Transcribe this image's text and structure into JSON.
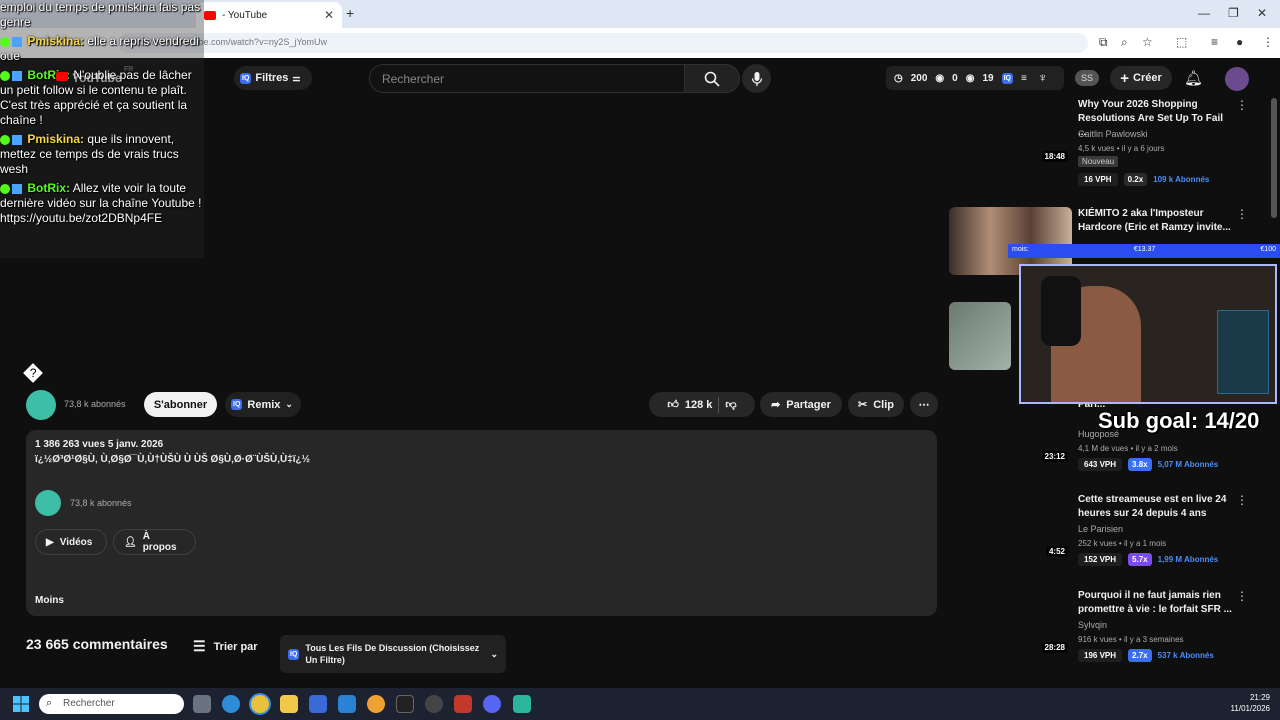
{
  "browser": {
    "tab_title": "- YouTube",
    "url": "https://www.youtube.com/watch?v=ny2S_jYomUw",
    "new_tab_glyph": "+",
    "close_glyph": "✕"
  },
  "youtube": {
    "logo": "YouTube",
    "country": "FR",
    "filters_label": "Filtres",
    "iq_label": "IQ",
    "search_placeholder": "Rechercher",
    "stats": {
      "a": "200",
      "b": "0",
      "c": "19"
    },
    "ss_label": "SS",
    "create_label": "Créer"
  },
  "chat": [
    {
      "user": "",
      "text": "emploi du temps de pmiskina fais pas genre"
    },
    {
      "user": "Pmiskina:",
      "text": "elle a repris vendredi oue"
    },
    {
      "user": "BotRix:",
      "text": "N'oublie pas de lâcher un petit follow si le contenu te plaît. C'est très apprécié et ça soutient la chaîne !"
    },
    {
      "user": "Pmiskina:",
      "text": "que ils innovent, mettez ce temps ds de vrais trucs wesh"
    },
    {
      "user": "BotRix:",
      "text": "Allez vite voir la toute dernière vidéo sur la chaîne Youtube ! https://youtu.be/zot2DBNp4FE"
    }
  ],
  "video": {
    "question_mark": "?",
    "channel_subs": "73,8 k abonnés",
    "subscribe_label": "S'abonner",
    "remix_label": "Remix",
    "likes": "128 k",
    "share_label": "Partager",
    "clip_label": "Clip",
    "views_date": "1 386 263 vues  5 janv. 2026",
    "description_garbled": "ï¿½Ø³Ø¹Ø§Ù‚ Ù‚Ø§Ø¯Ù‚Ù†ÙŠÙ Ù  ÙŠ Ø§Ù‚Ø·Ø¨ÙŠÙ‚Ù‡ï¿½",
    "videos_label": "Vidéos",
    "about_label": "À propos",
    "less_label": "Moins",
    "comments_count": "23 665 commentaires",
    "sort_label": "Trier par",
    "threads_label": "Tous Les Fils De Discussion (Choisissez Un Filtre)"
  },
  "recommendations": [
    {
      "title": "Why Your 2026 Shopping Resolutions Are Set Up To Fail ...",
      "channel": "Caitlin Pawlowski",
      "meta": "4,5 k vues • il y a 6 jours",
      "duration": "18:48",
      "badge_new": "Nouveau",
      "vph": "16 VPH",
      "mult": "0.2x",
      "subs_num": "109 k",
      "subs_label": "Abonnés"
    },
    {
      "title": "KIÉMITO 2 aka l'Imposteur Hardcore (Eric et Ramzy invite...",
      "channel": "",
      "meta": "",
      "duration": ""
    },
    {
      "title": "Pari...",
      "channel": "Hugoposé",
      "meta": "4,1 M de vues • il y a 2 mois",
      "duration": "23:12",
      "vph": "643 VPH",
      "mult": "3.8x",
      "subs_num": "5,07 M",
      "subs_label": "Abonnés"
    },
    {
      "title": "Cette streameuse est en live 24 heures sur 24 depuis 4 ans",
      "channel": "Le Parisien",
      "meta": "252 k vues • il y a 1 mois",
      "duration": "4:52",
      "vph": "152 VPH",
      "mult": "5.7x",
      "subs_num": "1,99 M",
      "subs_label": "Abonnés"
    },
    {
      "title": "Pourquoi il ne faut jamais rien promettre à vie : le forfait SFR ...",
      "channel": "Sylvqin",
      "meta": "916 k vues • il y a 3 semaines",
      "duration": "28:28",
      "vph": "196 VPH",
      "mult": "2.7x",
      "subs_num": "537 k",
      "subs_label": "Abonnés"
    }
  ],
  "overlay": {
    "donation_left": "mois:",
    "donation_mid": "€13.37",
    "donation_right": "€100",
    "sub_goal": "Sub goal: 14/20"
  },
  "taskbar": {
    "search_placeholder": "Rechercher",
    "time": "21:29",
    "date": "11/01/2026"
  },
  "colors": {
    "accent_blue": "#3b6ff2",
    "kick_green": "#53fc18",
    "yt_red": "#ff0000"
  }
}
